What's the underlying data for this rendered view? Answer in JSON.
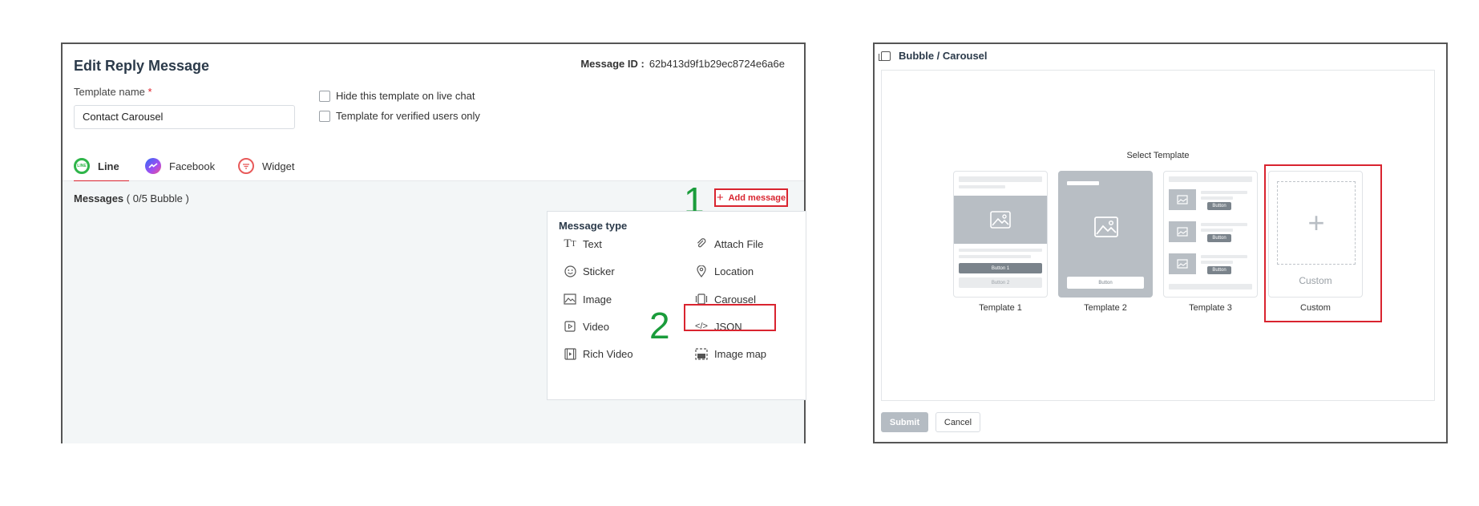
{
  "edit": {
    "title": "Edit Reply Message",
    "message_id_label": "Message ID :",
    "message_id_value": "62b413d9f1b29ec8724e6a6e",
    "template_name_label": "Template name",
    "required_mark": "*",
    "template_name_value": "Contact Carousel",
    "checkbox_hide": "Hide this template on live chat",
    "checkbox_verified": "Template for verified users only"
  },
  "tabs": [
    {
      "label": "Line",
      "icon": "line-icon",
      "color": "#2fb54a"
    },
    {
      "label": "Facebook",
      "icon": "messenger-icon",
      "color": "#7b4cf0"
    },
    {
      "label": "Widget",
      "icon": "widget-icon",
      "color": "#e85a5a"
    }
  ],
  "messages": {
    "label": "Messages",
    "count": "( 0/5 Bubble )",
    "add_button": "Add message"
  },
  "steps": {
    "one": "1",
    "two": "2"
  },
  "menu": {
    "title": "Message type",
    "items": [
      {
        "label": "Text",
        "icon": "text-icon"
      },
      {
        "label": "Attach File",
        "icon": "paperclip-icon"
      },
      {
        "label": "Sticker",
        "icon": "smiley-icon"
      },
      {
        "label": "Location",
        "icon": "location-pin-icon"
      },
      {
        "label": "Image",
        "icon": "image-icon"
      },
      {
        "label": "Carousel",
        "icon": "carousel-icon"
      },
      {
        "label": "Video",
        "icon": "video-icon"
      },
      {
        "label": "JSON",
        "icon": "code-icon"
      },
      {
        "label": "Rich Video",
        "icon": "rich-video-icon"
      },
      {
        "label": "Image map",
        "icon": "image-map-icon"
      }
    ]
  },
  "bubble": {
    "title": "Bubble / Carousel",
    "select_label": "Select Template",
    "templates": [
      "Template 1",
      "Template 2",
      "Template 3",
      "Custom"
    ],
    "custom_card_text": "Custom",
    "t1_button1": "Button 1",
    "t1_button2": "Button 2",
    "t2_button": "Button",
    "t3_button": "Button",
    "submit": "Submit",
    "cancel": "Cancel"
  },
  "colors": {
    "accent_red": "#d9242f",
    "step_green": "#1a9c3b"
  }
}
